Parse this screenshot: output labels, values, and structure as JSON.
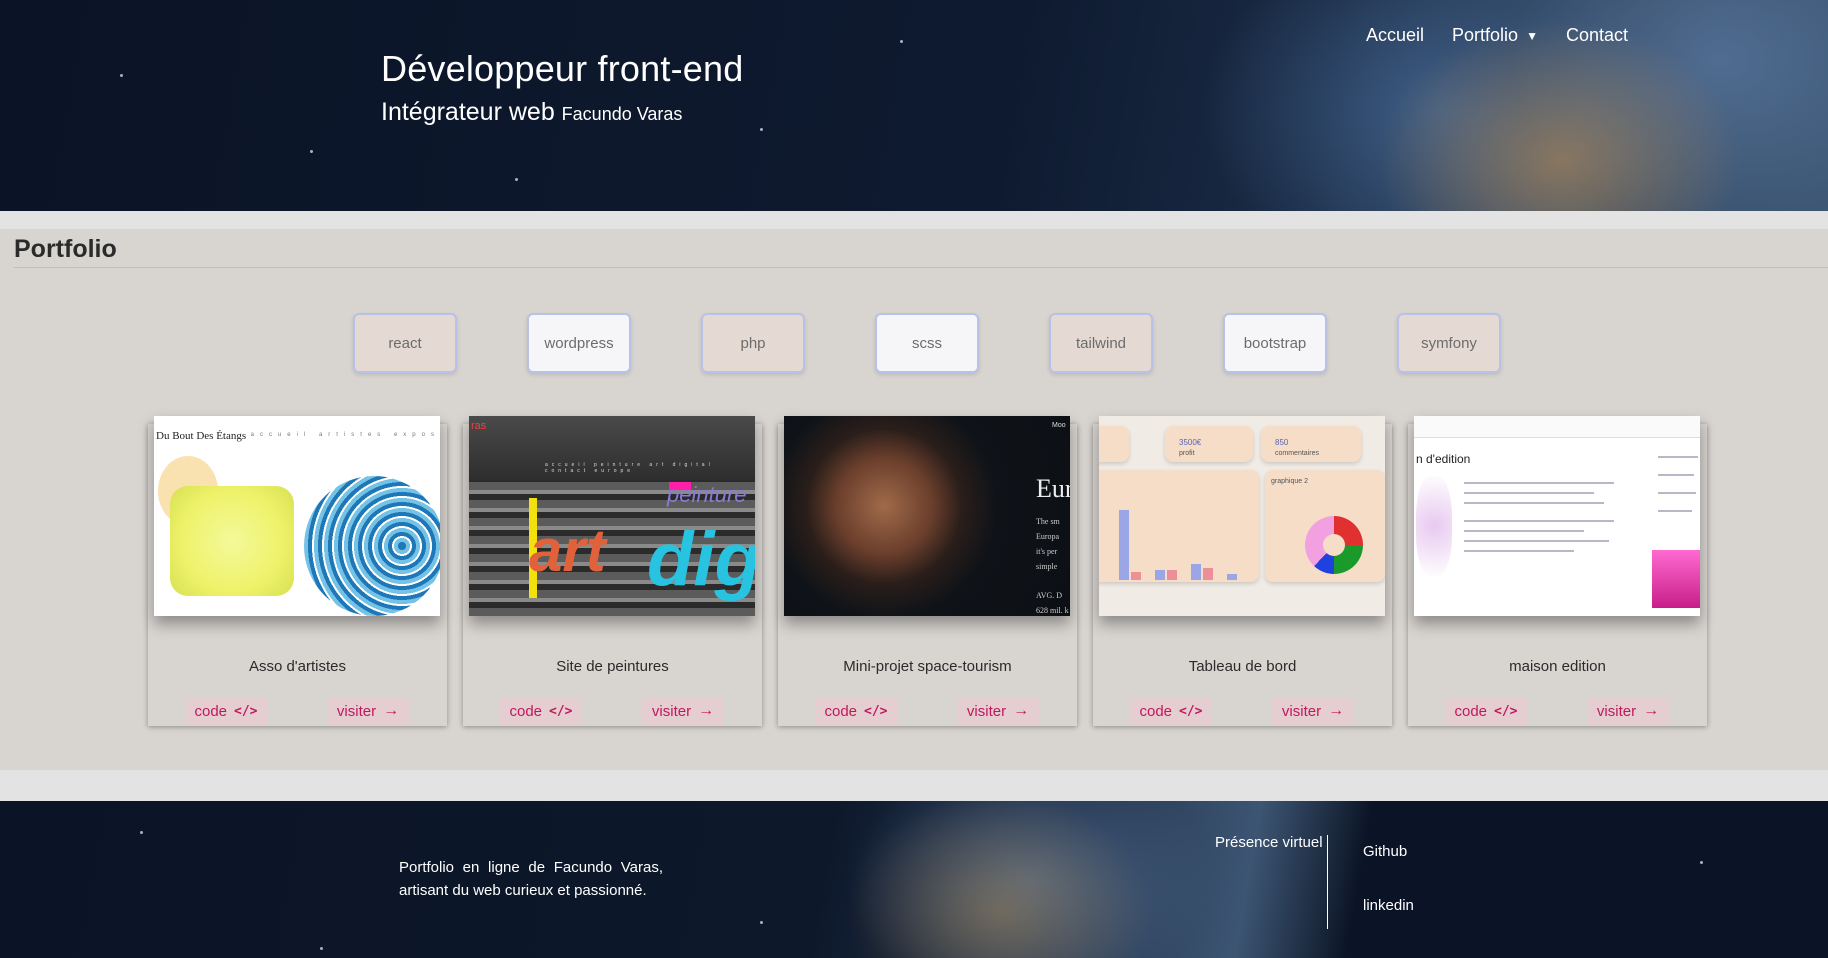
{
  "header": {
    "title": "Développeur front-end",
    "subtitle": "Intégrateur web",
    "name": "Facundo Varas",
    "nav": [
      {
        "label": "Accueil"
      },
      {
        "label": "Portfolio",
        "has_dropdown": true
      },
      {
        "label": "Contact"
      }
    ]
  },
  "portfolio": {
    "title": "Portfolio",
    "filters": [
      "react",
      "wordpress",
      "php",
      "scss",
      "tailwind",
      "bootstrap",
      "symfony"
    ],
    "projects": [
      {
        "title": "Asso d'artistes",
        "code_label": "code",
        "visit_label": "visiter"
      },
      {
        "title": "Site de peintures",
        "code_label": "code",
        "visit_label": "visiter"
      },
      {
        "title": "Mini-projet space-tourism",
        "code_label": "code",
        "visit_label": "visiter"
      },
      {
        "title": "Tableau de bord",
        "code_label": "code",
        "visit_label": "visiter"
      },
      {
        "title": "maison edition",
        "code_label": "code",
        "visit_label": "visiter"
      }
    ],
    "thumbnails": {
      "t1": {
        "site_title": "Du Bout Des Étangs",
        "nav": "accueil   artistes   expos"
      },
      "t2": {
        "corner": "ras",
        "nav": "accueil   peinture   art digital   contact   europe",
        "word_art": "art",
        "word_dig": "dig",
        "word_peint": "peinture"
      },
      "t3": {
        "heading": "Eur",
        "menu": "Moo",
        "text": "The sm Europa it's per simple",
        "stat": "AVG. D 628 mil. k"
      },
      "t4": {
        "stat1": "3500€",
        "stat1_label": "profit",
        "stat2": "850",
        "stat2_label": "commentaires",
        "chart_label": "graphique 2"
      },
      "t5": {
        "heading": "n d'edition"
      }
    }
  },
  "footer": {
    "text": "Portfolio en ligne de Facundo Varas, artisant du web curieux et passionné.",
    "presence": "Présence virtuel",
    "links": [
      "Github",
      "linkedin"
    ]
  },
  "colors": {
    "accent": "#c2185b",
    "button_bg": "#e4ced2",
    "section_bg": "#d8d4d0",
    "filter_border": "#b9c2e6",
    "header_bg": "#0b1426"
  },
  "icons": {
    "code": "code-icon",
    "visit": "arrow-right-icon",
    "dropdown": "caret-down-icon"
  }
}
